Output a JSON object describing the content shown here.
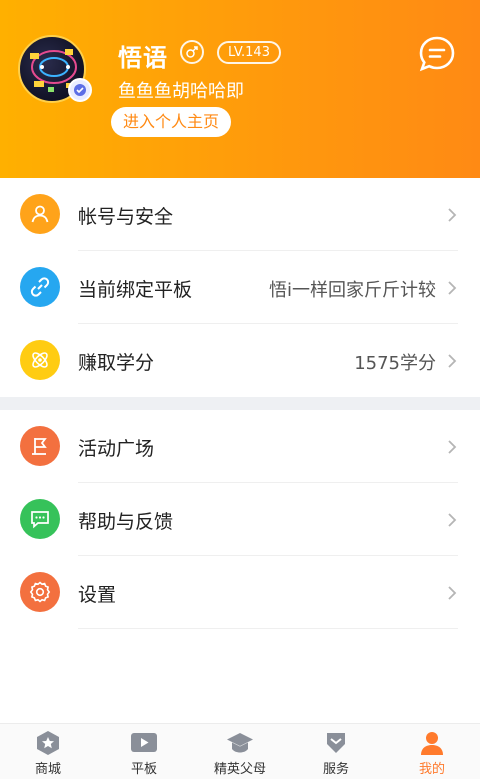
{
  "colors": {
    "header_start": "#ffb000",
    "header_end": "#ff8a14",
    "accent": "#ff7a2c",
    "tab_active": "#ff7a2c"
  },
  "profile": {
    "username": "悟语",
    "gender_icon": "male-icon",
    "level": "LV.143",
    "signature": "鱼鱼鱼胡哈哈即",
    "home_button": "进入个人主页",
    "message_icon": "chat-bubble-icon"
  },
  "menu_group_1": [
    {
      "label": "帐号与安全",
      "value": "",
      "icon": "user-icon",
      "color": "#ffa31a"
    },
    {
      "label": "当前绑定平板",
      "value": "悟i一样回家斤斤计较",
      "icon": "link-icon",
      "color": "#26a7f0"
    },
    {
      "label": "赚取学分",
      "value": "1575学分",
      "icon": "atom-icon",
      "color": "#ffcc12"
    }
  ],
  "menu_group_2": [
    {
      "label": "活动广场",
      "value": "",
      "icon": "flag-icon",
      "color": "#f3703f"
    },
    {
      "label": "帮助与反馈",
      "value": "",
      "icon": "feedback-icon",
      "color": "#36c25a"
    },
    {
      "label": "设置",
      "value": "",
      "icon": "gear-icon",
      "color": "#f3703f"
    }
  ],
  "tabbar": [
    {
      "label": "商城",
      "icon": "star-badge-icon",
      "active": false
    },
    {
      "label": "平板",
      "icon": "play-icon",
      "active": false
    },
    {
      "label": "精英父母",
      "icon": "graduation-cap-icon",
      "active": false
    },
    {
      "label": "服务",
      "icon": "service-icon",
      "active": false
    },
    {
      "label": "我的",
      "icon": "person-icon",
      "active": true
    }
  ]
}
